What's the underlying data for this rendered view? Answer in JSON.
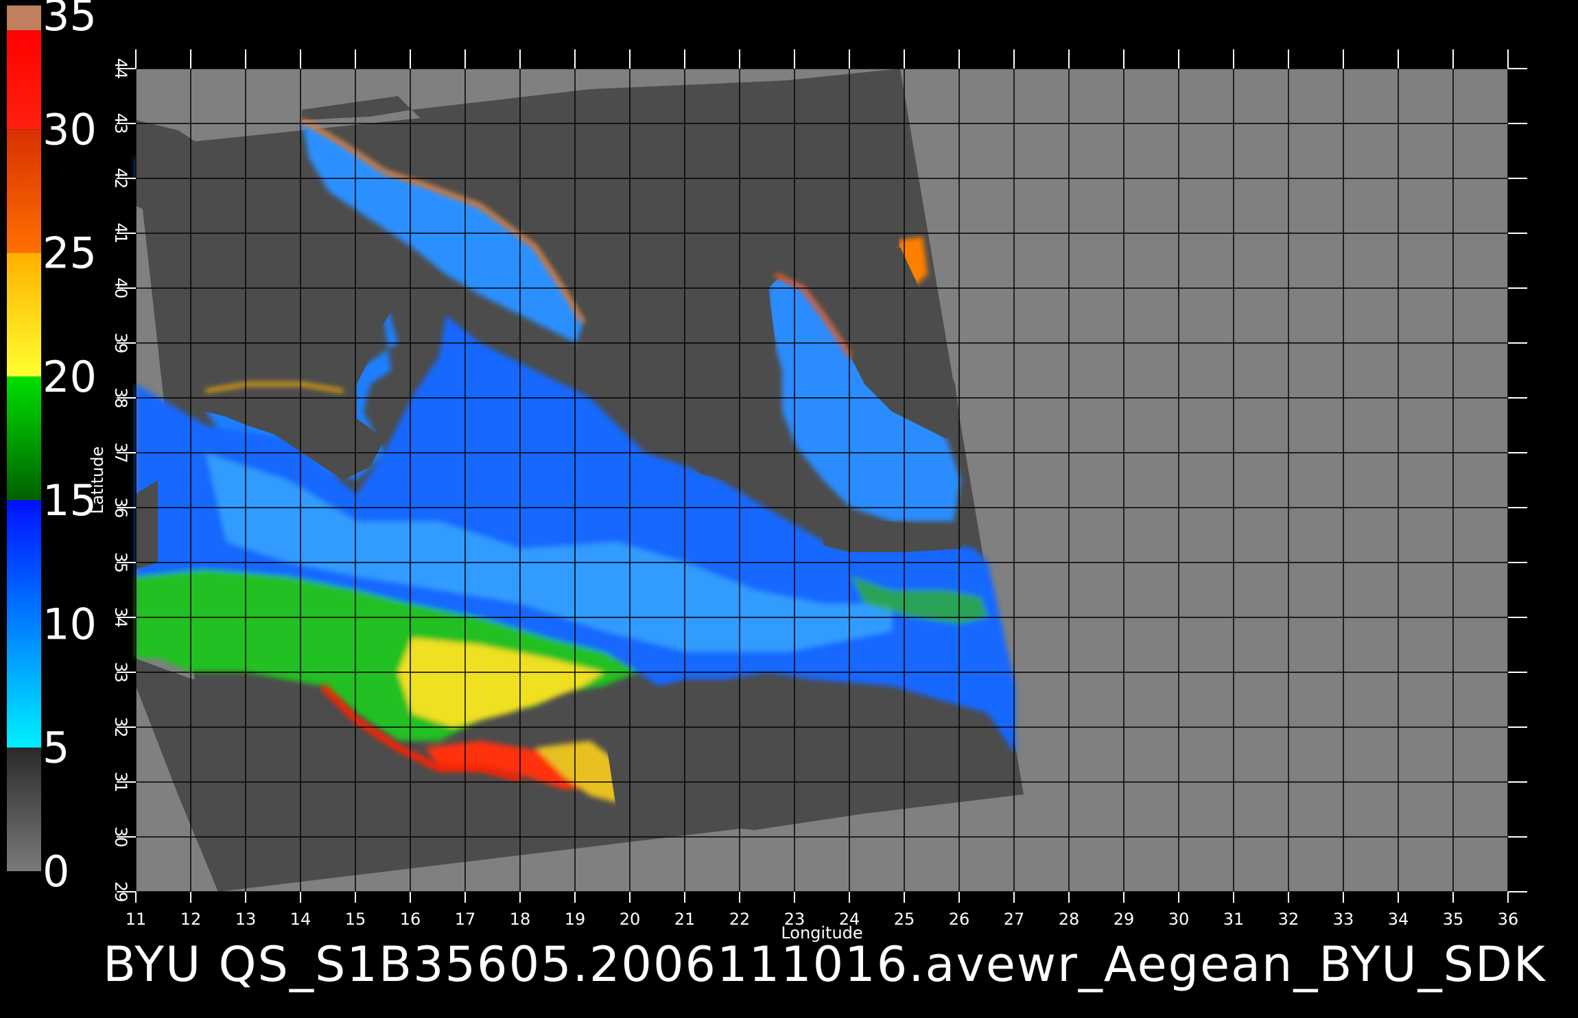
{
  "colorbar": {
    "labels": [
      "35",
      "30",
      "25",
      "20",
      "15",
      "10",
      "5",
      "0"
    ],
    "stops": [
      {
        "from": 0,
        "to": 5,
        "colors": [
          "#7a7a7a",
          "#2a2a2a"
        ]
      },
      {
        "from": 5,
        "to": 15,
        "colors": [
          "#00f0ff",
          "#0010ff"
        ]
      },
      {
        "from": 15,
        "to": 20,
        "colors": [
          "#006000",
          "#00e000"
        ]
      },
      {
        "from": 20,
        "to": 25,
        "colors": [
          "#ffff30",
          "#ffb000"
        ]
      },
      {
        "from": 25,
        "to": 30,
        "colors": [
          "#ff7000",
          "#d83000"
        ]
      },
      {
        "from": 30,
        "to": 34,
        "colors": [
          "#ff2010",
          "#ff0000"
        ]
      },
      {
        "from": 34,
        "to": 35,
        "colors": [
          "#c08060",
          "#c08060"
        ]
      }
    ]
  },
  "map": {
    "xlabel": "Longitude",
    "ylabel": "Latitude",
    "xlim": [
      11,
      36
    ],
    "ylim": [
      29,
      44
    ],
    "x_ticks": [
      "11",
      "12",
      "13",
      "14",
      "15",
      "16",
      "17",
      "18",
      "19",
      "20",
      "21",
      "22",
      "23",
      "24",
      "25",
      "26",
      "27",
      "28",
      "29",
      "30",
      "31",
      "32",
      "33",
      "34",
      "35",
      "36"
    ],
    "y_ticks": [
      "29",
      "30",
      "31",
      "32",
      "33",
      "34",
      "35",
      "36",
      "37",
      "38",
      "39",
      "40",
      "41",
      "42",
      "43",
      "44"
    ],
    "colors": {
      "background": "#000000",
      "no_data": "#808080",
      "land": "#4c4c4c",
      "grid": "#000000"
    }
  },
  "footer": {
    "title": "BYU  QS_S1B35605.2006111016.avewr_Aegean_BYU_SDK"
  }
}
